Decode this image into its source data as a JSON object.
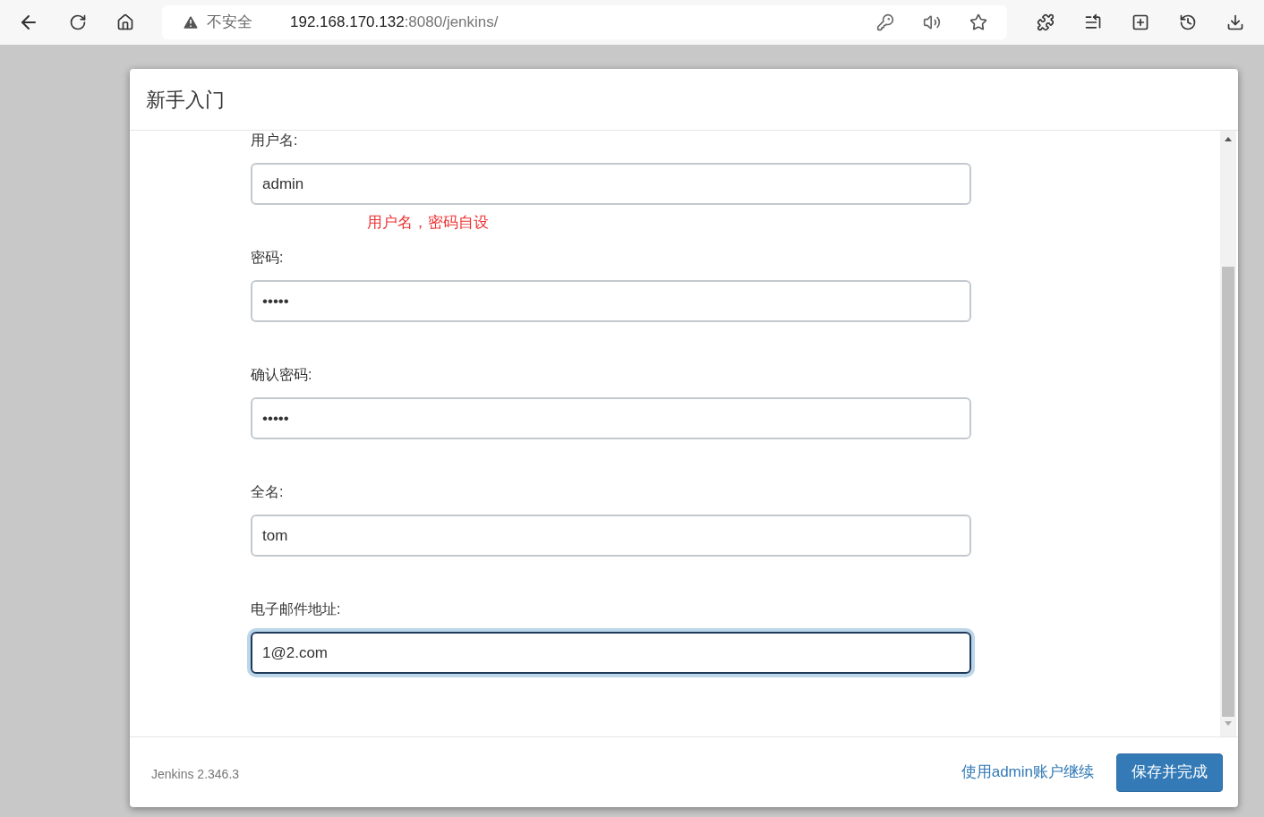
{
  "browser": {
    "security": "不安全",
    "url_host": "192.168.170.132",
    "url_rest": ":8080/jenkins/"
  },
  "dialog": {
    "title": "新手入门",
    "fields": [
      {
        "label": "用户名:",
        "value": "admin",
        "focused": false,
        "note": "用户名，密码自设"
      },
      {
        "label": "密码:",
        "value": "•••••",
        "focused": false
      },
      {
        "label": "确认密码:",
        "value": "•••••",
        "focused": false
      },
      {
        "label": "全名:",
        "value": "tom",
        "focused": false
      },
      {
        "label": "电子邮件地址:",
        "value": "1@2.com",
        "focused": true
      }
    ],
    "version": "Jenkins 2.346.3",
    "link": "使用admin账户继续",
    "button": "保存并完成"
  }
}
